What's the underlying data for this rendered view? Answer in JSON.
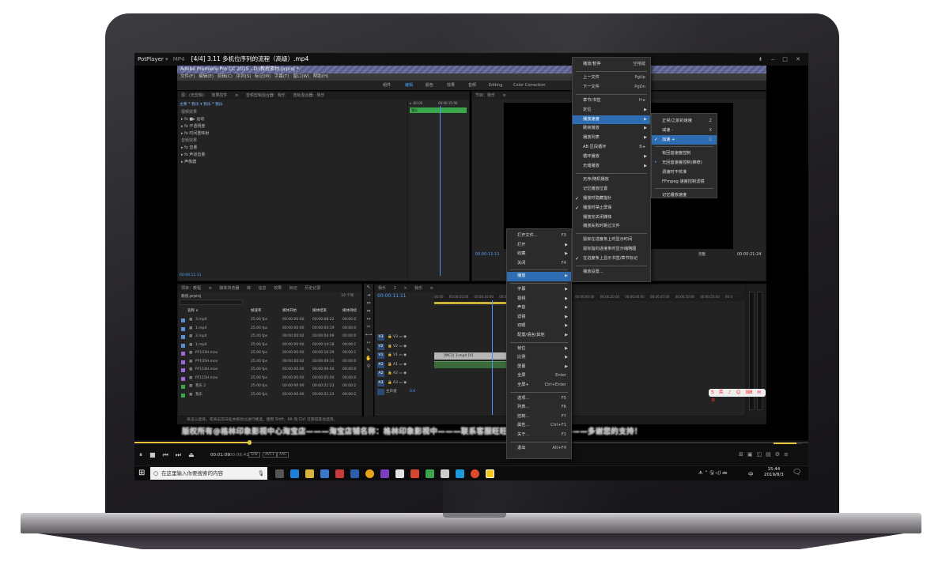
{
  "potplayer": {
    "brand": "PotPlayer",
    "format": "MP4",
    "title": "[4/4] 3.11 多机位序列的流程（高级）.mp4",
    "window_controls": "⇟ ‒ □ ✕"
  },
  "premiere": {
    "title": "Adobe Premiere Pro CC 2015 - D:\\教程素材.prproj *",
    "menus": "文件(F)  编辑(E)  剪辑(C)  序列(S)  标记(M)  字幕(T)  窗口(W)  帮助(H)",
    "workspaces": [
      "组件",
      "编辑",
      "颜色",
      "效果",
      "音频",
      "Editing",
      "Color Correction"
    ],
    "effect_controls": {
      "tabs": "源：(无剪辑)   效果控件 ≡   音频剪辑混合器：我乐   音轨混合器：我乐",
      "clip": "主要 * 我乐   ▾ 我乐 * 我乐",
      "rows": [
        "视频效果",
        "▸ fx ■▸ 运动",
        "▸ fx 不透明度",
        "▸ fx 时间重映射",
        "音频效果",
        "▸ fx 音量",
        "▸ fx 声道音量",
        "▸ 声像器"
      ],
      "time": "00:00:11:11",
      "ruler": [
        "▸ :00:00",
        "00:00:15:00"
      ],
      "clip_label": "我乐"
    },
    "program": {
      "tab": "节目：我乐 ≡",
      "timecode": "00:00:11:11",
      "fit": "完整",
      "duration": "00:00:21:24"
    },
    "project": {
      "tabs": "项目：教程 ≡   媒体浏览器   库   信息   效果   标记   历史记录",
      "file": "教程.prproj",
      "count": "10 个项",
      "columns": [
        "名称 ∧",
        "帧速率",
        "媒体开始",
        "媒体结束",
        "媒体持续"
      ],
      "rows": [
        {
          "name": "3.mp4",
          "fps": "25.00 fps",
          "start": "00:00:00:00",
          "end": "00:00:08:22",
          "dur": "00:00:0",
          "color": "#5b8fd8"
        },
        {
          "name": "1.mp4",
          "fps": "25.00 fps",
          "start": "00:00:00:00",
          "end": "00:00:04:19",
          "dur": "00:00:0",
          "color": "#5b8fd8"
        },
        {
          "name": "2.mp4",
          "fps": "25.00 fps",
          "start": "00:00:00:00",
          "end": "00:00:04:09",
          "dur": "00:00:0",
          "color": "#5b8fd8"
        },
        {
          "name": "1.mp4",
          "fps": "25.00 fps",
          "start": "00:00:00:00",
          "end": "00:00:14:18",
          "dur": "00:00:1",
          "color": "#5b8fd8"
        },
        {
          "name": "PF103H.mov",
          "fps": "25.00 fps",
          "start": "00:00:00:00",
          "end": "00:00:16:29",
          "dur": "00:00:1",
          "color": "#9b6ad8"
        },
        {
          "name": "PF105H.mov",
          "fps": "25.00 fps",
          "start": "00:00:00:00",
          "end": "00:00:09:10",
          "dur": "00:00:0",
          "color": "#9b6ad8"
        },
        {
          "name": "PF114H.mov",
          "fps": "25.00 fps",
          "start": "00:00:00:00",
          "end": "00:00:09:04",
          "dur": "00:00:0",
          "color": "#9b6ad8"
        },
        {
          "name": "PF115H.mov",
          "fps": "25.00 fps",
          "start": "00:00:00:00",
          "end": "00:00:05:04",
          "dur": "00:00:0",
          "color": "#9b6ad8"
        },
        {
          "name": "我乐 2",
          "fps": "25.00 fps",
          "start": "00:00:00:00",
          "end": "00:00:21:23",
          "dur": "00:00:2",
          "color": "#3aa84a"
        },
        {
          "name": "我乐",
          "fps": "25.00 fps",
          "start": "00:00:00:00",
          "end": "00:00:21:23",
          "dur": "00:00:2",
          "color": "#3aa84a"
        }
      ]
    },
    "timeline": {
      "tabs": "我乐 2   × 我乐 ≡",
      "timecode": "00:00:11:11",
      "tracks": [
        "V3",
        "V2",
        "V1",
        "A1",
        "A2",
        "A3",
        "主声道"
      ],
      "clip": "[MC1] 3.mp4 [V]",
      "master_value": "0.0",
      "ruler": "00:00   00:00:05:00   00:00:10:00   00:00:15:00",
      "ruler_right": "00:00:00:00   00:00:20:00   00:00:40:00   00:00:45:00   00:00:50:00   00:00:55:00   00:0"
    },
    "hint": "单击以选择，或单击空白处并拖动以进行框选。使用 Shift、Alt 和 Ctrl 可获得其他选项。"
  },
  "marquee": "版权所有@格林印象影视中心淘宝店———淘宝店铺名称：格林印象影视中———联系客服旺旺：387509543———多谢您的支持！",
  "main_menu": {
    "items": [
      {
        "label": "打开文件...",
        "sc": "F3",
        "sep_after": false
      },
      {
        "label": "打开",
        "ar": true
      },
      {
        "label": "收藏",
        "ar": true
      },
      {
        "label": "关闭",
        "sc": "F4",
        "sep_after": true
      },
      {
        "label": "播放",
        "ar": true,
        "hl": true,
        "sep_after": true
      },
      {
        "label": "字幕",
        "ar": true
      },
      {
        "label": "视频",
        "ar": true
      },
      {
        "label": "声音",
        "ar": true
      },
      {
        "label": "滤镜",
        "ar": true
      },
      {
        "label": "双眼",
        "ar": true
      },
      {
        "label": "配置/语言/其他",
        "ar": true,
        "sep_after": true
      },
      {
        "label": "帧位",
        "ar": true
      },
      {
        "label": "比例",
        "ar": true
      },
      {
        "label": "屏幕",
        "ar": true
      },
      {
        "label": "全屏",
        "sc": "Enter"
      },
      {
        "label": "全屏+",
        "sc": "Ctrl+Enter",
        "sep_after": true
      },
      {
        "label": "选项...",
        "sc": "F5"
      },
      {
        "label": "列表...",
        "sc": "F6"
      },
      {
        "label": "控制...",
        "sc": "F7"
      },
      {
        "label": "属性...",
        "sc": "Ctrl+F1"
      },
      {
        "label": "关于...",
        "sc": "F1",
        "sep_after": true
      },
      {
        "label": "退出",
        "sc": "Alt+F4"
      }
    ]
  },
  "play_menu": {
    "items": [
      {
        "label": "播放/暂停",
        "sc": "空格键",
        "sep_after": true
      },
      {
        "label": "上一文件",
        "sc": "PgUp"
      },
      {
        "label": "下一文件",
        "sc": "PgDn",
        "sep_after": true
      },
      {
        "label": "章节/书签",
        "sc": "H ▸"
      },
      {
        "label": "定位",
        "ar": true
      },
      {
        "label": "播放速度",
        "ar": true,
        "hl": true
      },
      {
        "label": "跳帧播放",
        "ar": true
      },
      {
        "label": "播放列表",
        "ar": true
      },
      {
        "label": "AB 区段循环",
        "sc": "B ▸"
      },
      {
        "label": "循环播放",
        "ar": true
      },
      {
        "label": "无缝播放",
        "ar": true,
        "sep_after": true
      },
      {
        "label": "无序/随机播放"
      },
      {
        "label": "记忆播放位置"
      },
      {
        "label": "播放时隐藏指针",
        "ck": true
      },
      {
        "label": "播放时禁止屏保",
        "ck": true
      },
      {
        "label": "播放完关闭媒体"
      },
      {
        "label": "播放失败时跳过文件",
        "sep_after": true
      },
      {
        "label": "鼠标在进度条上时显示时间"
      },
      {
        "label": "鼠标指向进度条时显示缩略图"
      },
      {
        "label": "在进度条上显示书签/章节标记",
        "ck": true,
        "sep_after": true
      },
      {
        "label": "播放设置..."
      }
    ]
  },
  "speed_menu": {
    "items": [
      {
        "label": "正常/之前的速度",
        "sc": "Z"
      },
      {
        "label": "减速 -",
        "sc": "X"
      },
      {
        "label": "加速 +",
        "sc": "C",
        "ck": true,
        "hl": true,
        "sep_after": true
      },
      {
        "label": "有回音速度控制"
      },
      {
        "label": "无回音速度控制(推荐)",
        "dot": true
      },
      {
        "label": "调速时不校准"
      },
      {
        "label": "FFmpeg 速度控制滤镜",
        "sep_after": true
      },
      {
        "label": "记忆播放速度"
      }
    ]
  },
  "controls": {
    "time": "00:01:09",
    "total": "00:06:41",
    "tags": [
      "S/W",
      "AVC1",
      "AAC"
    ],
    "progress_pct": 17,
    "volume_pct": 80
  },
  "taskbar": {
    "search_placeholder": "在这里输入你要搜索的内容",
    "clock_time": "15:44",
    "clock_date": "2019/8/3",
    "ime": "中",
    "tray": "ᗑ ⌃ 🖫 ◁) 🖮"
  },
  "colors": {
    "accent": "#2f6db3",
    "timecode": "#4fa3ff",
    "clip_green": "#3aa84a",
    "playhead": "#4f8ffd"
  }
}
